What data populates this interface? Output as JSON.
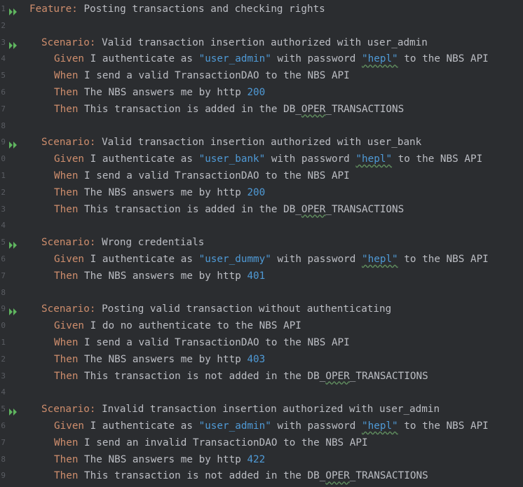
{
  "colors": {
    "background": "#2b2d30",
    "keyword": "#cf8e6d",
    "string": "#4f9ad6",
    "number": "#4f9ad6",
    "text": "#bcbec4",
    "run_icon": "#5fb55f",
    "line_number": "#5a5d63"
  },
  "lines": [
    {
      "ln": "1",
      "run": true,
      "indent": 0,
      "tokens": [
        [
          "kw",
          "Feature:"
        ],
        [
          "txt",
          " Posting transactions and checking rights"
        ]
      ]
    },
    {
      "ln": "2",
      "run": false,
      "indent": 0,
      "tokens": []
    },
    {
      "ln": "3",
      "run": true,
      "indent": 1,
      "tokens": [
        [
          "kw",
          "Scenario:"
        ],
        [
          "txt",
          " Valid transaction insertion authorized with user_admin"
        ]
      ]
    },
    {
      "ln": "4",
      "run": false,
      "indent": 2,
      "tokens": [
        [
          "kw",
          "Given"
        ],
        [
          "txt",
          " I authenticate as "
        ],
        [
          "str",
          "\"user_admin\""
        ],
        [
          "txt",
          " with password "
        ],
        [
          "strsp",
          "\"hepl\""
        ],
        [
          "txt",
          " to the NBS API"
        ]
      ]
    },
    {
      "ln": "5",
      "run": false,
      "indent": 2,
      "tokens": [
        [
          "kw",
          "When"
        ],
        [
          "txt",
          " I send a valid TransactionDAO to the NBS API"
        ]
      ]
    },
    {
      "ln": "6",
      "run": false,
      "indent": 2,
      "tokens": [
        [
          "kw",
          "Then"
        ],
        [
          "txt",
          " The NBS answers me by http "
        ],
        [
          "num",
          "200"
        ]
      ]
    },
    {
      "ln": "7",
      "run": false,
      "indent": 2,
      "tokens": [
        [
          "kw",
          "Then"
        ],
        [
          "txt",
          " This transaction is added in the DB_"
        ],
        [
          "sp",
          "OPER"
        ],
        [
          "txt",
          "_TRANSACTIONS"
        ]
      ]
    },
    {
      "ln": "8",
      "run": false,
      "indent": 0,
      "tokens": []
    },
    {
      "ln": "9",
      "run": true,
      "indent": 1,
      "tokens": [
        [
          "kw",
          "Scenario:"
        ],
        [
          "txt",
          " Valid transaction insertion authorized with user_bank"
        ]
      ]
    },
    {
      "ln": "0",
      "run": false,
      "indent": 2,
      "tokens": [
        [
          "kw",
          "Given"
        ],
        [
          "txt",
          " I authenticate as "
        ],
        [
          "str",
          "\"user_bank\""
        ],
        [
          "txt",
          " with password "
        ],
        [
          "strsp",
          "\"hepl\""
        ],
        [
          "txt",
          " to the NBS API"
        ]
      ]
    },
    {
      "ln": "1",
      "run": false,
      "indent": 2,
      "tokens": [
        [
          "kw",
          "When"
        ],
        [
          "txt",
          " I send a valid TransactionDAO to the NBS API"
        ]
      ]
    },
    {
      "ln": "2",
      "run": false,
      "indent": 2,
      "tokens": [
        [
          "kw",
          "Then"
        ],
        [
          "txt",
          " The NBS answers me by http "
        ],
        [
          "num",
          "200"
        ]
      ]
    },
    {
      "ln": "3",
      "run": false,
      "indent": 2,
      "tokens": [
        [
          "kw",
          "Then"
        ],
        [
          "txt",
          " This transaction is added in the DB_"
        ],
        [
          "sp",
          "OPER"
        ],
        [
          "txt",
          "_TRANSACTIONS"
        ]
      ]
    },
    {
      "ln": "4",
      "run": false,
      "indent": 0,
      "tokens": []
    },
    {
      "ln": "5",
      "run": true,
      "indent": 1,
      "tokens": [
        [
          "kw",
          "Scenario:"
        ],
        [
          "txt",
          " Wrong credentials"
        ]
      ]
    },
    {
      "ln": "6",
      "run": false,
      "indent": 2,
      "tokens": [
        [
          "kw",
          "Given"
        ],
        [
          "txt",
          " I authenticate as "
        ],
        [
          "str",
          "\"user_dummy\""
        ],
        [
          "txt",
          " with password "
        ],
        [
          "strsp",
          "\"hepl\""
        ],
        [
          "txt",
          " to the NBS API"
        ]
      ]
    },
    {
      "ln": "7",
      "run": false,
      "indent": 2,
      "tokens": [
        [
          "kw",
          "Then"
        ],
        [
          "txt",
          " The NBS answers me by http "
        ],
        [
          "num",
          "401"
        ]
      ]
    },
    {
      "ln": "8",
      "run": false,
      "indent": 0,
      "tokens": []
    },
    {
      "ln": "9",
      "run": true,
      "indent": 1,
      "tokens": [
        [
          "kw",
          "Scenario:"
        ],
        [
          "txt",
          " Posting valid transaction without authenticating"
        ]
      ]
    },
    {
      "ln": "0",
      "run": false,
      "indent": 2,
      "tokens": [
        [
          "kw",
          "Given"
        ],
        [
          "txt",
          " I do no authenticate to the NBS API"
        ]
      ]
    },
    {
      "ln": "1",
      "run": false,
      "indent": 2,
      "tokens": [
        [
          "kw",
          "When"
        ],
        [
          "txt",
          " I send a valid TransactionDAO to the NBS API"
        ]
      ]
    },
    {
      "ln": "2",
      "run": false,
      "indent": 2,
      "tokens": [
        [
          "kw",
          "Then"
        ],
        [
          "txt",
          " The NBS answers me by http "
        ],
        [
          "num",
          "403"
        ]
      ]
    },
    {
      "ln": "3",
      "run": false,
      "indent": 2,
      "tokens": [
        [
          "kw",
          "Then"
        ],
        [
          "txt",
          " This transaction is not added in the DB_"
        ],
        [
          "sp",
          "OPER"
        ],
        [
          "txt",
          "_TRANSACTIONS"
        ]
      ]
    },
    {
      "ln": "4",
      "run": false,
      "indent": 0,
      "tokens": []
    },
    {
      "ln": "5",
      "run": true,
      "indent": 1,
      "tokens": [
        [
          "kw",
          "Scenario:"
        ],
        [
          "txt",
          " Invalid transaction insertion authorized with user_admin"
        ]
      ]
    },
    {
      "ln": "6",
      "run": false,
      "indent": 2,
      "tokens": [
        [
          "kw",
          "Given"
        ],
        [
          "txt",
          " I authenticate as "
        ],
        [
          "str",
          "\"user_admin\""
        ],
        [
          "txt",
          " with password "
        ],
        [
          "strsp",
          "\"hepl\""
        ],
        [
          "txt",
          " to the NBS API"
        ]
      ]
    },
    {
      "ln": "7",
      "run": false,
      "indent": 2,
      "tokens": [
        [
          "kw",
          "When"
        ],
        [
          "txt",
          " I send an invalid TransactionDAO to the NBS API"
        ]
      ]
    },
    {
      "ln": "8",
      "run": false,
      "indent": 2,
      "tokens": [
        [
          "kw",
          "Then"
        ],
        [
          "txt",
          " The NBS answers me by http "
        ],
        [
          "num",
          "422"
        ]
      ]
    },
    {
      "ln": "9",
      "run": false,
      "indent": 2,
      "tokens": [
        [
          "kw",
          "Then"
        ],
        [
          "txt",
          " This transaction is not added in the DB_"
        ],
        [
          "sp",
          "OPER"
        ],
        [
          "txt",
          "_TRANSACTIONS"
        ]
      ]
    }
  ]
}
